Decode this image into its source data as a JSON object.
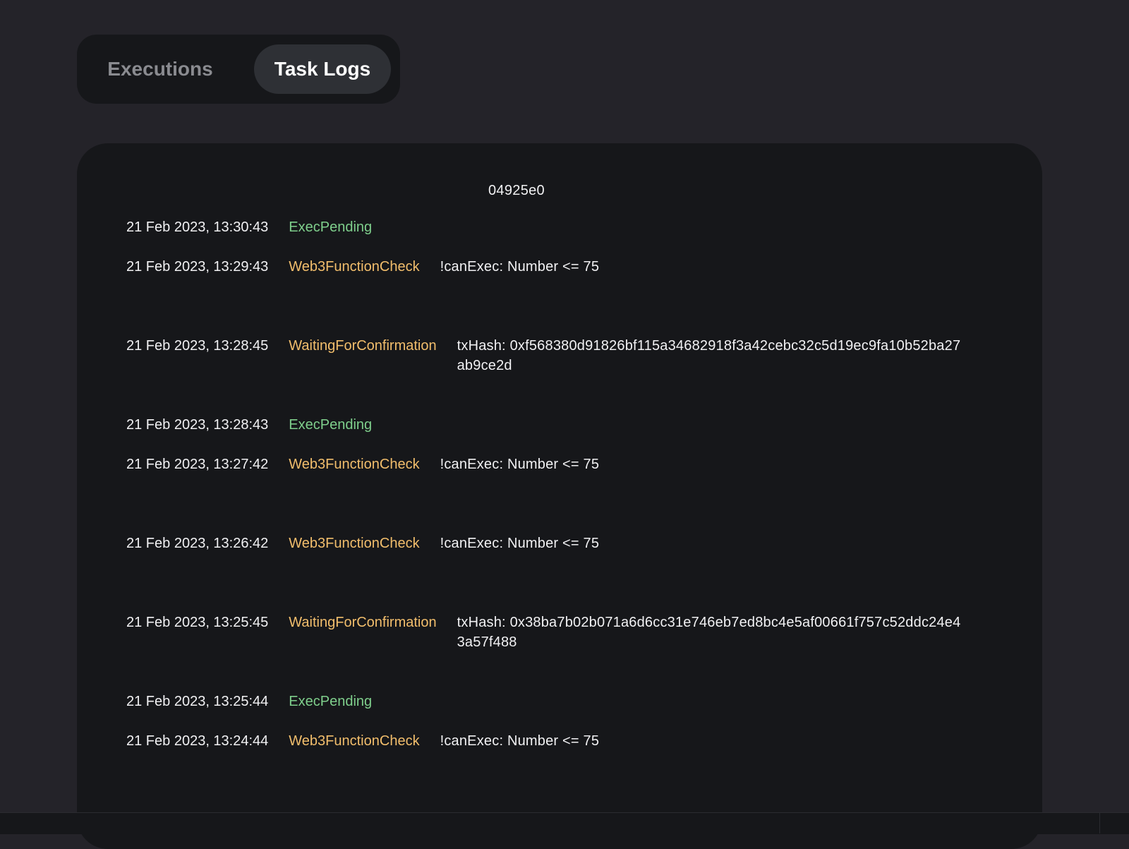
{
  "tabs": [
    {
      "label": "Executions",
      "active": false
    },
    {
      "label": "Task Logs",
      "active": true
    }
  ],
  "execution_id": "04925e0",
  "logs": [
    {
      "time": "21 Feb 2023, 13:30:43",
      "status": "ExecPending",
      "message": ""
    },
    {
      "time": "21 Feb 2023, 13:29:43",
      "status": "Web3FunctionCheck",
      "message": "!canExec: Number <= 75"
    },
    {
      "time": "21 Feb 2023, 13:28:45",
      "status": "WaitingForConfirmation",
      "message": "txHash: 0xf568380d91826bf115a34682918f3a42cebc32c5d19ec9fa10b52ba27ab9ce2d"
    },
    {
      "time": "21 Feb 2023, 13:28:43",
      "status": "ExecPending",
      "message": ""
    },
    {
      "time": "21 Feb 2023, 13:27:42",
      "status": "Web3FunctionCheck",
      "message": "!canExec: Number <= 75"
    },
    {
      "time": "21 Feb 2023, 13:26:42",
      "status": "Web3FunctionCheck",
      "message": "!canExec: Number <= 75"
    },
    {
      "time": "21 Feb 2023, 13:25:45",
      "status": "WaitingForConfirmation",
      "message": "txHash: 0x38ba7b02b071a6d6cc31e746eb7ed8bc4e5af00661f757c52ddc24e43a57f488"
    },
    {
      "time": "21 Feb 2023, 13:25:44",
      "status": "ExecPending",
      "message": ""
    },
    {
      "time": "21 Feb 2023, 13:24:44",
      "status": "Web3FunctionCheck",
      "message": "!canExec: Number <= 75"
    }
  ],
  "colors": {
    "background": "#242329",
    "panel": "#16171a",
    "exec_pending": "#7fcf8c",
    "function_check": "#f2be6c",
    "waiting_confirmation": "#f2be6c"
  }
}
